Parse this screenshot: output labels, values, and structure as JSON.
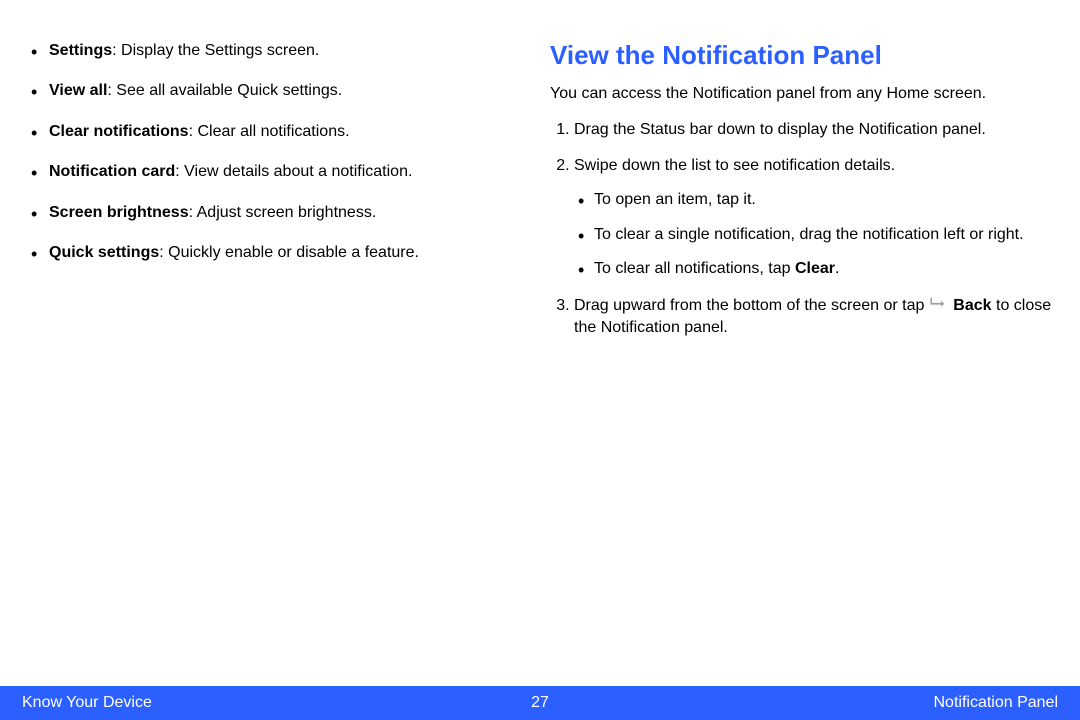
{
  "left": {
    "items": [
      {
        "term": "Settings",
        "desc": ": Display the Settings screen."
      },
      {
        "term": "View all",
        "desc": ": See all available Quick settings."
      },
      {
        "term": "Clear notifications",
        "desc": ": Clear all notifications."
      },
      {
        "term": "Notification card",
        "desc": ": View details about a notification."
      },
      {
        "term": "Screen brightness",
        "desc": ": Adjust screen brightness."
      },
      {
        "term": "Quick settings",
        "desc": ": Quickly enable or disable a feature."
      }
    ]
  },
  "right": {
    "heading": "View the Notification Panel",
    "intro": "You can access the Notification panel from any Home screen.",
    "step1": "Drag the Status bar down to display the Notification panel.",
    "step2": "Swipe down the list to see notification details.",
    "step2_sub": {
      "a": "To open an item, tap it.",
      "b": "To clear a single notification, drag the notification left or right.",
      "c_pre": "To clear all notifications, tap ",
      "c_bold": "Clear",
      "c_post": "."
    },
    "step3": {
      "pre": "Drag upward from the bottom of the screen or tap ",
      "bold": "Back",
      "post": " to close the Notification panel."
    }
  },
  "footer": {
    "left": "Know Your Device",
    "page": "27",
    "right": "Notification Panel"
  }
}
